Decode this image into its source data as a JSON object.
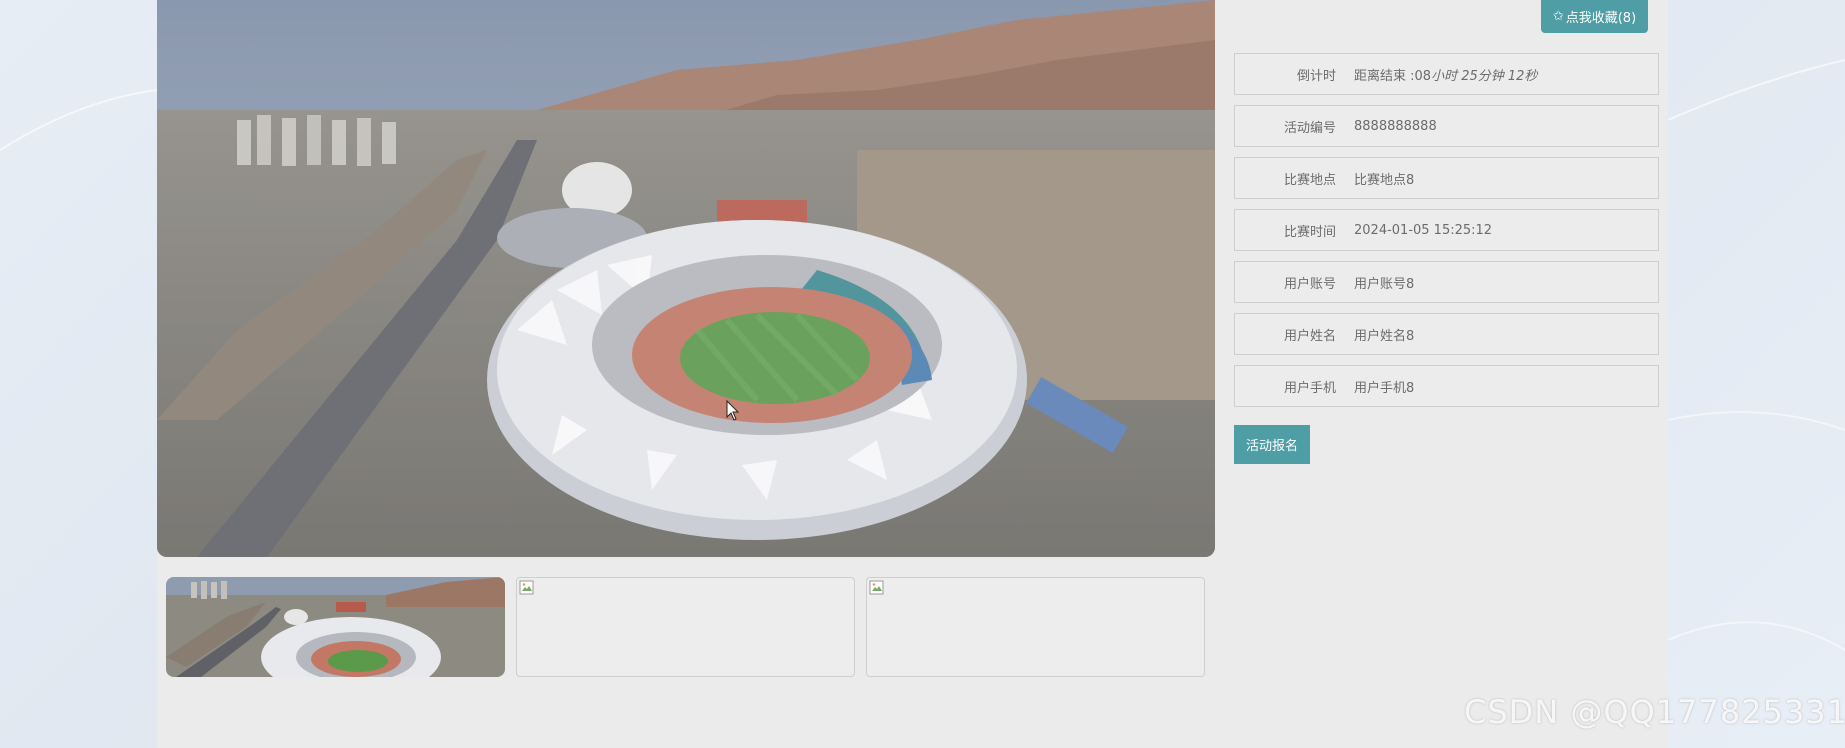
{
  "favorite": {
    "star": "✩",
    "label": "点我收藏(8)"
  },
  "info": [
    {
      "label": "倒计时",
      "value_prefix": "距离结束 :08",
      "value_rest": "小时 25分钟 12秒"
    },
    {
      "label": "活动编号",
      "value": "8888888888"
    },
    {
      "label": "比赛地点",
      "value": "比赛地点8"
    },
    {
      "label": "比赛时间",
      "value": "2024-01-05 15:25:12"
    },
    {
      "label": "用户账号",
      "value": "用户账号8"
    },
    {
      "label": "用户姓名",
      "value": "用户姓名8"
    },
    {
      "label": "用户手机",
      "value": "用户手机8"
    }
  ],
  "signup": {
    "label": "活动报名"
  },
  "watermark": "CSDN @QQ177825331",
  "colors": {
    "accent": "#4f9ea5",
    "panel": "#ebebeb",
    "row_border": "#cfcfcf",
    "text": "#6c6c6c"
  },
  "icons": {
    "favorite": "star-outline-icon",
    "broken_image": "broken-image-icon",
    "cursor": "mouse-cursor-icon"
  }
}
